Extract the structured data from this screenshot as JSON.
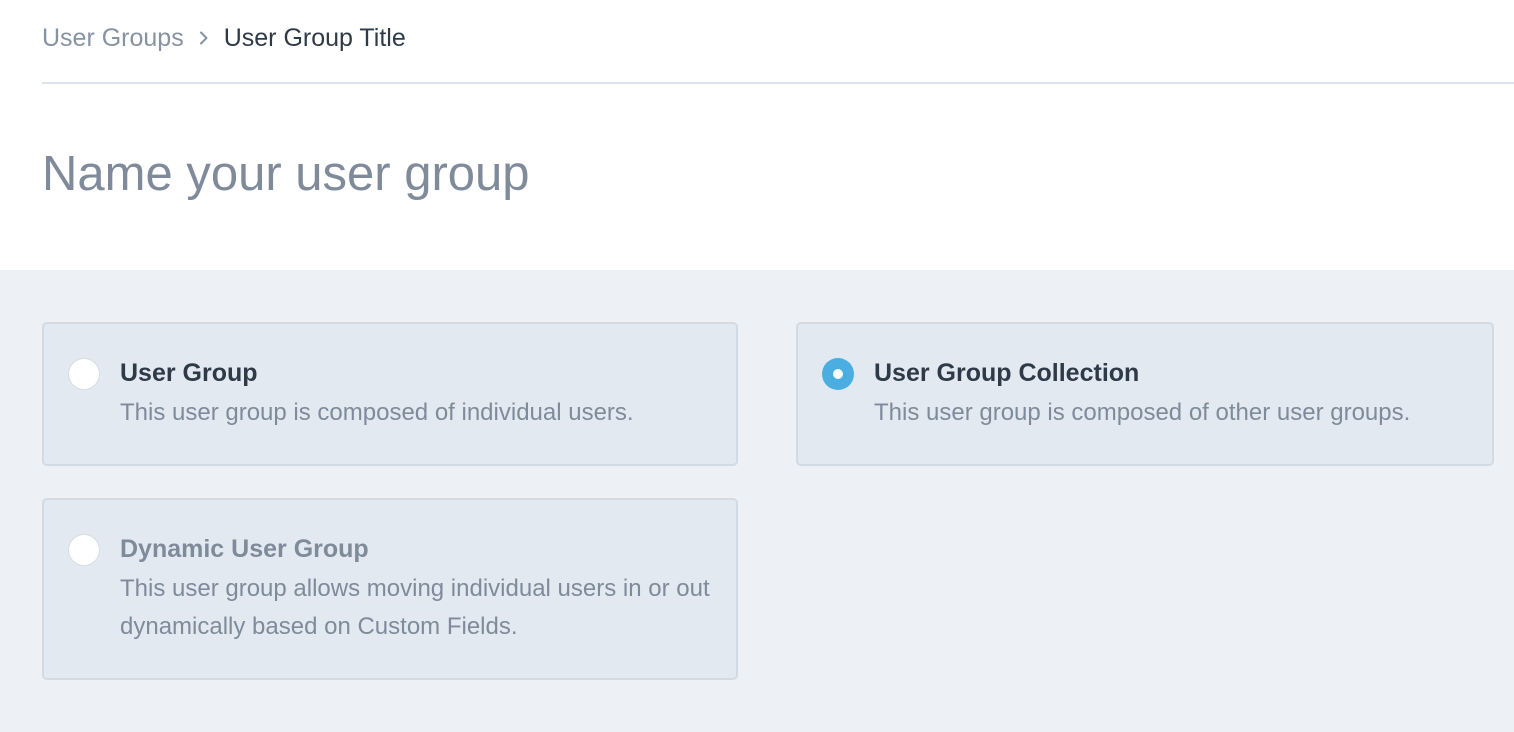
{
  "breadcrumb": {
    "parent": "User Groups",
    "current": "User Group Title",
    "separator_icon": "chevron-right-icon"
  },
  "title": "Name your user group",
  "options": {
    "selected": "user_group_collection",
    "user_group": {
      "title": "User Group",
      "description": "This user group is composed of individual users."
    },
    "user_group_collection": {
      "title": "User Group Collection",
      "description": "This user group is composed of other user groups."
    },
    "dynamic_user_group": {
      "title": "Dynamic User Group",
      "description": "This user group allows moving individual users in or out dynamically based on Custom Fields."
    }
  },
  "colors": {
    "accent": "#4aaee0",
    "text_dark": "#2f3a48",
    "text_muted": "#7f8b9a",
    "panel_bg": "#edf0f4",
    "card_bg": "#e3e9f0"
  }
}
